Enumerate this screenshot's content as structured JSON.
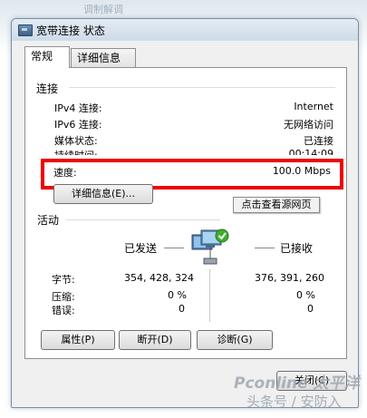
{
  "background_title": "调制解调",
  "window": {
    "title": "宽带连接 状态",
    "tabs": [
      "常规",
      "详细信息"
    ]
  },
  "connection": {
    "section": "连接",
    "rows": [
      {
        "label": "IPv4 连接:",
        "value": "Internet"
      },
      {
        "label": "IPv6 连接:",
        "value": "无网络访问"
      },
      {
        "label": "媒体状态:",
        "value": "已连接"
      },
      {
        "label": "持续时间:",
        "value": "00:14:09"
      },
      {
        "label": "速度:",
        "value": "100.0 Mbps"
      }
    ],
    "details_button": "详细信息(E)...",
    "tooltip": "点击查看源网页"
  },
  "activity": {
    "section": "活动",
    "sent_label": "已发送",
    "received_label": "已接收",
    "rows": [
      {
        "label": "字节:",
        "sent": "354, 428, 324",
        "received": "376, 391, 260"
      },
      {
        "label": "压缩:",
        "sent": "0 %",
        "received": "0 %"
      },
      {
        "label": "错误:",
        "sent": "0",
        "received": "0"
      }
    ]
  },
  "buttons": {
    "properties": "属性(P)",
    "disconnect": "断开(D)",
    "diagnose": "诊断(G)",
    "close": "关闭(C)"
  },
  "watermark": {
    "line1": "Pconline 太平洋",
    "line2": "头条号 / 安防入"
  },
  "colors": {
    "highlight": "#ee0000",
    "status_icon": "#3fae2f"
  }
}
